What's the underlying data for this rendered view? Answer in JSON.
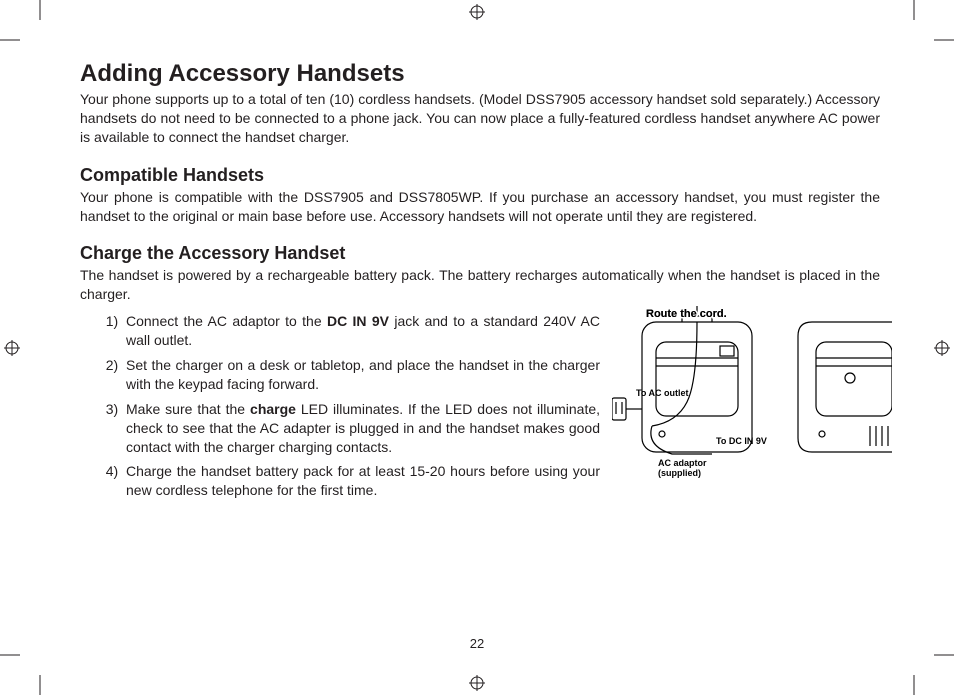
{
  "page_number": "22",
  "headings": {
    "main": "Adding Accessory Handsets",
    "compatible": "Compatible Handsets",
    "charge": "Charge the Accessory Handset"
  },
  "paragraphs": {
    "intro": "Your phone supports up to a total of ten (10) cordless handsets. (Model DSS7905 accessory handset sold separately.) Accessory handsets do not need to be connected to a phone jack. You can now place a fully-featured cordless handset anywhere AC power is available to connect the handset charger.",
    "compatible": "Your phone is compatible with the DSS7905 and DSS7805WP. If you purchase an accessory handset, you must register the handset to the original or main base before use. Accessory handsets will not operate until they are registered.",
    "charge_intro": "The handset is powered by a rechargeable battery pack. The battery recharges automatically when the handset is placed in the charger."
  },
  "steps": {
    "s1a": "Connect the AC adaptor to the ",
    "s1_bold": "DC IN 9V",
    "s1b": " jack and to a standard 240V AC wall outlet.",
    "s2": "Set the charger on a desk or tabletop, and place the handset in the charger with the keypad facing forward.",
    "s3a": "Make sure that the ",
    "s3_bold": "charge",
    "s3b": " LED illuminates. If the LED does not illuminate, check to see that the AC adapter is plugged in and the handset makes good contact with the charger charging contacts.",
    "s4": "Charge the handset battery pack for at least 15-20 hours before using your new cordless telephone for the first time."
  },
  "diagram_labels": {
    "route": "Route the cord.",
    "to_ac": "To AC outlet",
    "to_dc": "To DC IN 9V",
    "adaptor1": "AC adaptor",
    "adaptor2": "(supplied)"
  }
}
